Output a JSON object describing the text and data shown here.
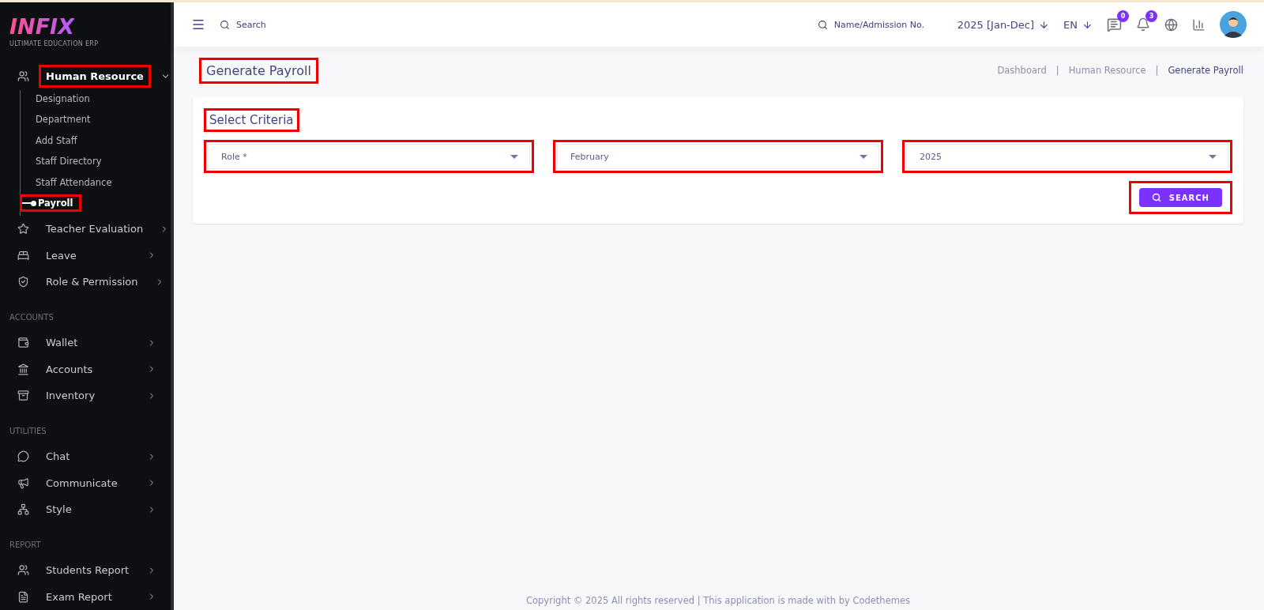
{
  "logo": {
    "wordmark": "INFIX",
    "tagline": "ULTIMATE EDUCATION ERP"
  },
  "sidebar": {
    "sections": [
      {
        "items": [
          {
            "label": "Human Resource",
            "expanded": true,
            "highlighted": true,
            "children": [
              {
                "label": "Designation",
                "selected": false,
                "highlighted": false
              },
              {
                "label": "Department",
                "selected": false,
                "highlighted": false
              },
              {
                "label": "Add Staff",
                "selected": false,
                "highlighted": false
              },
              {
                "label": "Staff Directory",
                "selected": false,
                "highlighted": false
              },
              {
                "label": "Staff Attendance",
                "selected": false,
                "highlighted": false
              },
              {
                "label": "Payroll",
                "selected": true,
                "highlighted": true
              }
            ]
          },
          {
            "label": "Teacher Evaluation",
            "expanded": false,
            "highlighted": false
          },
          {
            "label": "Leave",
            "expanded": false,
            "highlighted": false
          },
          {
            "label": "Role & Permission",
            "expanded": false,
            "highlighted": false
          }
        ]
      },
      {
        "header": "ACCOUNTS",
        "items": [
          {
            "label": "Wallet",
            "expanded": false,
            "highlighted": false
          },
          {
            "label": "Accounts",
            "expanded": false,
            "highlighted": false
          },
          {
            "label": "Inventory",
            "expanded": false,
            "highlighted": false
          }
        ]
      },
      {
        "header": "UTILITIES",
        "items": [
          {
            "label": "Chat",
            "expanded": false,
            "highlighted": false
          },
          {
            "label": "Communicate",
            "expanded": false,
            "highlighted": false
          },
          {
            "label": "Style",
            "expanded": false,
            "highlighted": false
          }
        ]
      },
      {
        "header": "REPORT",
        "items": [
          {
            "label": "Students Report",
            "expanded": false,
            "highlighted": false
          },
          {
            "label": "Exam Report",
            "expanded": false,
            "highlighted": false
          }
        ]
      }
    ]
  },
  "topbar": {
    "search": {
      "placeholder": "Search"
    },
    "student_search": {
      "placeholder": "Name/Admission No."
    },
    "session": "2025 [Jan-Dec]",
    "language": "EN",
    "messages_badge": "0",
    "notifications_badge": "3"
  },
  "page": {
    "title": "Generate Payroll",
    "title_highlighted": true,
    "breadcrumbs": [
      {
        "label": "Dashboard",
        "selected": false
      },
      {
        "label": "Human Resource",
        "selected": false
      },
      {
        "label": "Generate Payroll",
        "selected": true
      }
    ],
    "separator": "|"
  },
  "criteria": {
    "title": "Select Criteria",
    "title_highlighted": true,
    "selects": [
      {
        "value": "Role *",
        "highlighted": true
      },
      {
        "value": "February",
        "highlighted": true
      },
      {
        "value": "2025",
        "highlighted": true
      }
    ],
    "button": {
      "label": "SEARCH",
      "highlighted": true
    }
  },
  "footer": "Copyright © 2025 All rights reserved | This application is made with by Codethemes"
}
